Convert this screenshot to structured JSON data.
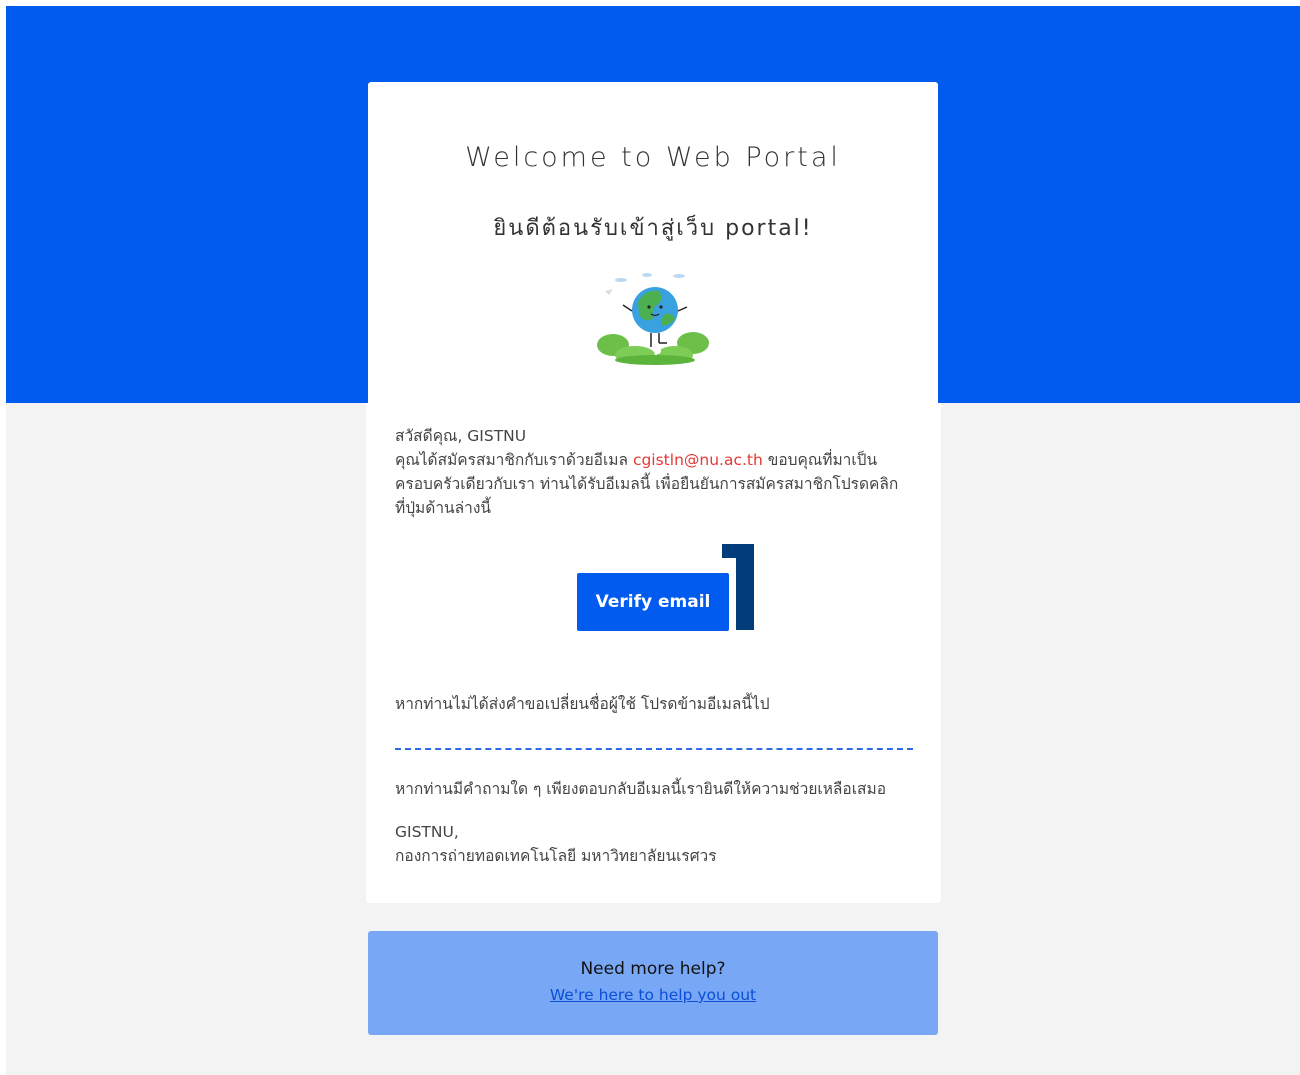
{
  "header": {
    "title": "Welcome to Web Portal",
    "subtitle": "ยินดีต้อนรับเข้าสู่เว็บ portal!"
  },
  "illustration": {
    "icon": "earth-mascot-illustration"
  },
  "message": {
    "greeting": "สวัสดีคุณ, GISTNU",
    "intro_before_email": "คุณได้สมัครสมาชิกกับเราด้วยอีเมล",
    "email": "cgistln@nu.ac.th",
    "intro_after_email": "ขอบคุณที่มาเป็น",
    "line2": "ครอบครัวเดียวกับเรา ท่านได้รับอีเมลนี้ เพื่อยืนยันการสมัครสมาชิกโปรดคลิก",
    "line3": "ที่ปุ่มด้านล่างนี้"
  },
  "verify_button": {
    "label": "Verify email"
  },
  "ignore_notice": "หากท่านไม่ได้ส่งคำขอเปลี่ยนชื่อผู้ใช้ โปรดข้ามอีเมลนี้ไป",
  "question_notice": "หากท่านมีคำถามใด ๆ เพียงตอบกลับอีเมลนี้เรายินดีให้ความช่วยเหลือเสมอ",
  "signature": {
    "name": "GISTNU,",
    "organization": "กองการถ่ายทอดเทคโนโลยี มหาวิทยาลัยนเรศวร"
  },
  "help": {
    "title": "Need more help?",
    "link_label": "We're here to help you out"
  },
  "colors": {
    "brand_blue": "#005bee",
    "email_red": "#e53935",
    "help_box": "#78a7f5",
    "callout_marker": "#003d7a"
  }
}
